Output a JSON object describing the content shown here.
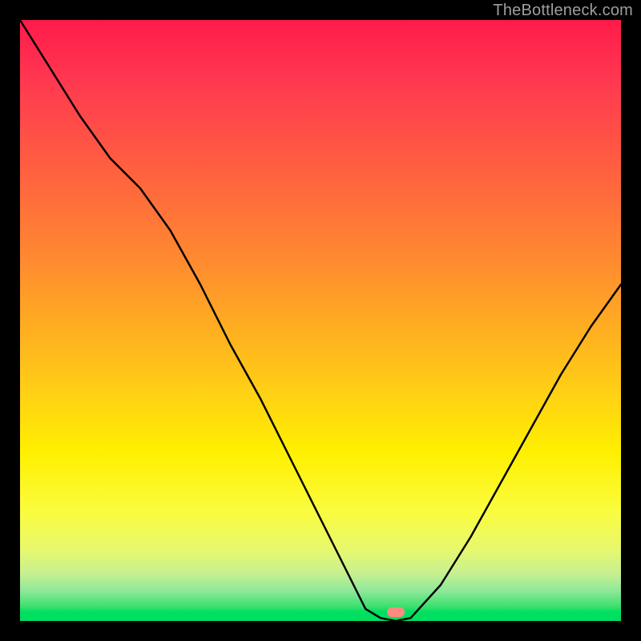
{
  "watermark": "TheBottleneck.com",
  "marker": {
    "x_frac": 0.625,
    "y_frac": 0.985
  },
  "chart_data": {
    "type": "line",
    "title": "",
    "xlabel": "",
    "ylabel": "",
    "xlim": [
      0,
      1
    ],
    "ylim": [
      0,
      1
    ],
    "note": "Axes have no tick labels; values are normalized fractions of the plot area. y is bottleneck magnitude (1=red/top, 0=green/bottom). The curve dips to ~0 near x≈0.60–0.65 and rises on both sides.",
    "series": [
      {
        "name": "bottleneck-curve",
        "x": [
          0.0,
          0.05,
          0.1,
          0.15,
          0.2,
          0.25,
          0.3,
          0.35,
          0.4,
          0.45,
          0.5,
          0.55,
          0.575,
          0.6,
          0.625,
          0.65,
          0.7,
          0.75,
          0.8,
          0.85,
          0.9,
          0.95,
          1.0
        ],
        "y": [
          1.0,
          0.92,
          0.84,
          0.77,
          0.72,
          0.65,
          0.56,
          0.46,
          0.37,
          0.27,
          0.17,
          0.07,
          0.02,
          0.005,
          0.0,
          0.005,
          0.06,
          0.14,
          0.23,
          0.32,
          0.41,
          0.49,
          0.56
        ]
      }
    ],
    "background_gradient": {
      "direction": "vertical",
      "stops": [
        {
          "pos": 0.0,
          "color": "#ff1a4b"
        },
        {
          "pos": 0.5,
          "color": "#ffb020"
        },
        {
          "pos": 0.8,
          "color": "#fff000"
        },
        {
          "pos": 0.985,
          "color": "#00e060"
        },
        {
          "pos": 1.0,
          "color": "#00e060"
        }
      ]
    },
    "marker": {
      "x": 0.625,
      "y": 0.0,
      "color": "#ff8a80",
      "shape": "pill"
    }
  }
}
